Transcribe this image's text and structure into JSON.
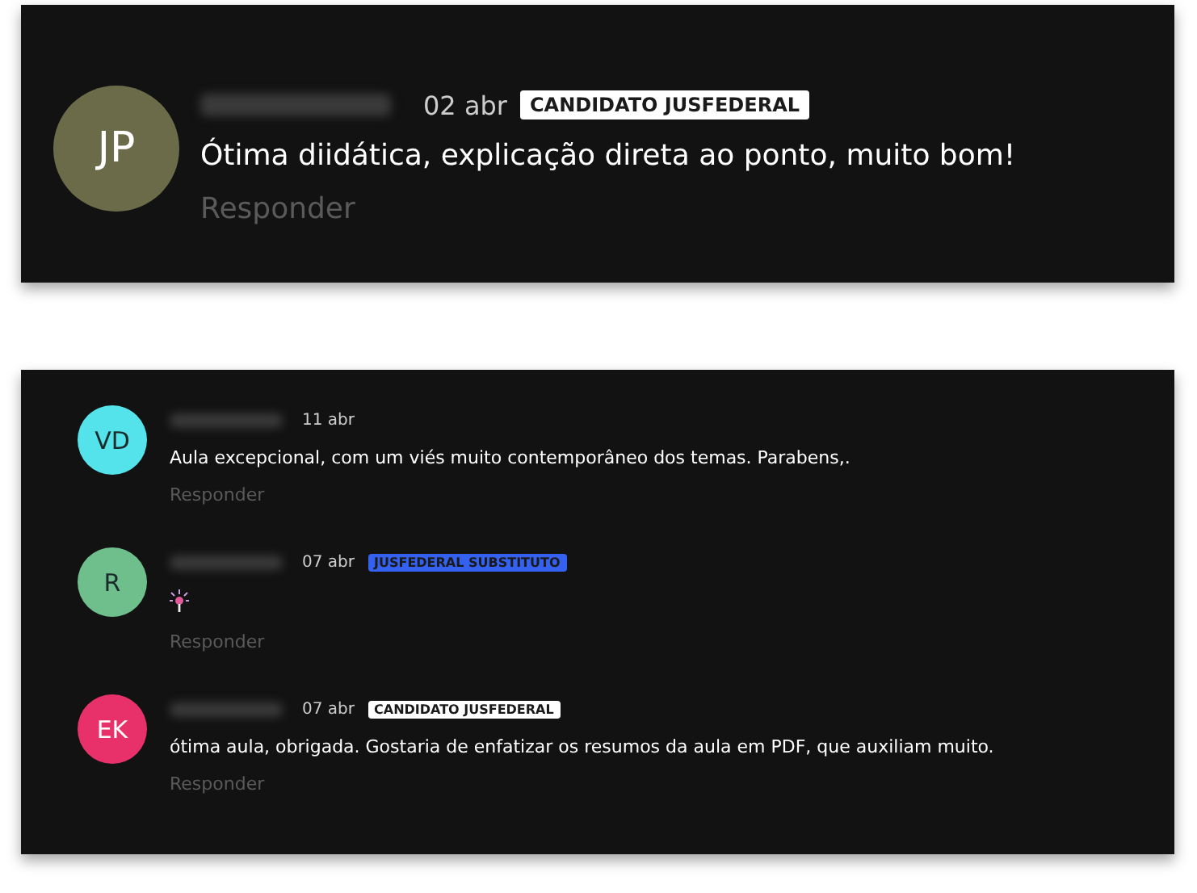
{
  "featured_comment": {
    "initials": "JP",
    "color": "#6b6b4a",
    "name_hidden": true,
    "date": "02 abr",
    "badge": {
      "label": "CANDIDATO JUSFEDERAL",
      "color": "#ffffff"
    },
    "kind": "text",
    "body": "Ótima diidática, explicação direta ao ponto, muito bom!",
    "reply_label": "Responder"
  },
  "comments": [
    {
      "initials": "VD",
      "color": "#54e3ea",
      "name_hidden": true,
      "date": "11 abr",
      "kind": "text",
      "body": "Aula excepcional, com um viés muito contemporâneo dos temas. Parabens,.",
      "reply_label": "Responder"
    },
    {
      "initials": "R",
      "color": "#6fbf8d",
      "name_hidden": true,
      "date": "07 abr",
      "badge": {
        "label": "JUSFEDERAL SUBSTITUTO",
        "color": "#3461f0"
      },
      "kind": "emoji",
      "reply_label": "Responder"
    },
    {
      "initials": "EK",
      "color": "#e8306b",
      "name_hidden": true,
      "date": "07 abr",
      "badge": {
        "label": "CANDIDATO JUSFEDERAL",
        "color": "#ffffff"
      },
      "kind": "text",
      "body": "ótima aula, obrigada. Gostaria de enfatizar os resumos da aula em PDF, que auxiliam muito.",
      "reply_label": "Responder"
    }
  ]
}
